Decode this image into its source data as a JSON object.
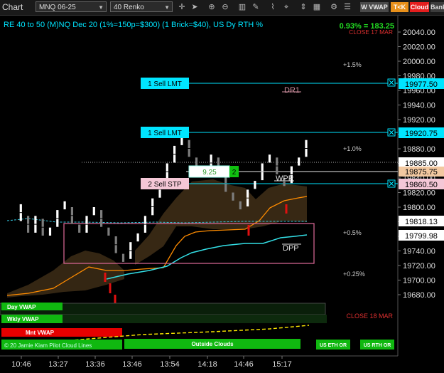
{
  "toolbar": {
    "title": "Chart",
    "instrument": "MNQ 06-25",
    "bar_type": "40 Renko",
    "wvwap": "W VWAP",
    "tok": "T<K",
    "cloud": "Cloud",
    "renko": "Banko",
    "icons": [
      "crosshair-icon",
      "cursor-icon",
      "zoom-in-icon",
      "zoom-out-icon",
      "bar-style-icon",
      "draw-tool-icon",
      "indicator-icon",
      "strategy-icon",
      "scale-icon",
      "layout-icon",
      "properties-icon",
      "menu-icon"
    ]
  },
  "chart_title": "RE 40 to 50 (M)NQ Dec 20 (1%=150p=$300) (1 Brick=$40), US Dy RTH %",
  "pnl": "0.93% = 183.25",
  "close_top": "CLOSE 17 MAR",
  "close_bottom": "CLOSE 18 MAR",
  "pct_labels": {
    "p15": "+1.5%",
    "p10": "+1.0%",
    "p05": "+0.5%",
    "p025": "+0.25%"
  },
  "level_labels": {
    "dr1": "DR1",
    "wpp": "WPP",
    "dpp": "DPP"
  },
  "orders": {
    "sell_lmt_1": "1 Sell LMT",
    "sell_lmt_2": "1 Sell LMT",
    "sell_stp": "2 Sell STP",
    "position_price": "9.25",
    "position_qty": "2"
  },
  "axis": {
    "ticks": [
      "20040.00",
      "20020.00",
      "20000.00",
      "19980.00",
      "19960.00",
      "19940.00",
      "19920.00",
      "19900.00",
      "19880.00",
      "19860.00",
      "19840.00",
      "19820.00",
      "19800.00",
      "19780.00",
      "19760.00",
      "19740.00",
      "19720.00",
      "19700.00",
      "19680.00"
    ],
    "tags": {
      "sell_lmt_1": "19977.50",
      "sell_lmt_2": "19920.75",
      "last": "19885.00",
      "avg": "19875.75",
      "sell_stp": "19860.50",
      "vwap": "19818.13",
      "cyan": "19799.98"
    }
  },
  "time_labels": [
    "10:46",
    "13:27",
    "13:36",
    "13:46",
    "13:54",
    "14:18",
    "14:46",
    "15:17"
  ],
  "panel": {
    "day_vwap": "Day VWAP",
    "wkly_vwap": "Wkly VWAP",
    "mnt_vwap": "Mnt VWAP",
    "cloud_lines": "© 20 Jamie Kiam Pilot Cloud Lines",
    "outside_clouds": "Outside Clouds",
    "us_eth": "US ETH OR",
    "us_rth": "US RTH OR"
  },
  "colors": {
    "order_cyan": "#00e5ff",
    "stop_pink": "#f4c7d6",
    "up_brick": "#ffffff",
    "down_brick": "#7d7d7d",
    "red_brick": "#e01010",
    "panel_green": "#10b810",
    "panel_red": "#e60000",
    "cloud_brown": "#3a2a15",
    "orange_line": "#ff8c00",
    "cyan_line": "#33dfe6"
  },
  "chart_data": {
    "type": "renko",
    "brick_size": 40,
    "ylim": [
      19665,
      20050
    ],
    "bricks": [
      [
        -19.0,
        19780.0,
        19792.0
      ],
      [
        -19.0,
        19792.0,
        19804.0
      ],
      [
        -18.0,
        19788.0,
        19776.0
      ],
      [
        -18.0,
        19776.0,
        19764.0
      ],
      [
        -17.0,
        19764.0,
        19776.0
      ],
      [
        -17.0,
        19776.0,
        19788.0
      ],
      [
        -16.0,
        19784.0,
        19772.0
      ],
      [
        -16.0,
        19772.0,
        19760.0
      ],
      [
        -15.0,
        19760.0,
        19772.0
      ],
      [
        -14.0,
        19772.0,
        19784.0
      ],
      [
        -14.0,
        19784.0,
        19796.0
      ],
      [
        -13.0,
        19796.0,
        19808.0
      ],
      [
        -12.0,
        19800.0,
        19788.0
      ],
      [
        -12.0,
        19788.0,
        19776.0
      ],
      [
        -11.0,
        19776.0,
        19764.0
      ],
      [
        -10.0,
        19764.0,
        19776.0
      ],
      [
        -10.0,
        19776.0,
        19788.0
      ],
      [
        -9.0,
        19788.0,
        19800.0
      ],
      [
        -8.0,
        19796.0,
        19784.0
      ],
      [
        -8.0,
        19784.0,
        19772.0
      ],
      [
        -7.0,
        19772.0,
        19760.0
      ],
      [
        -6.0,
        19760.0,
        19748.0
      ],
      [
        -6.0,
        19748.0,
        19736.0
      ],
      [
        -5.0,
        19736.0,
        19724.0
      ],
      [
        -4.0,
        19728.0,
        19740.0
      ],
      [
        -4.0,
        19740.0,
        19752.0
      ],
      [
        -3.0,
        19752.0,
        19764.0
      ],
      [
        -2.0,
        19764.0,
        19776.0
      ],
      [
        -2.0,
        19776.0,
        19788.0
      ],
      [
        -1.0,
        19788.0,
        19800.0
      ],
      [
        -1.0,
        19800.0,
        19812.0
      ],
      [
        0.0,
        19812.0,
        19824.0
      ],
      [
        0.0,
        19824.0,
        19836.0
      ],
      [
        1.0,
        19836.0,
        19848.0
      ],
      [
        1.0,
        19848.0,
        19860.0
      ],
      [
        2.0,
        19860.0,
        19872.0
      ],
      [
        2.0,
        19872.0,
        19884.0
      ],
      [
        3.0,
        19884.0,
        19896.0
      ],
      [
        4.0,
        19892.0,
        19880.0
      ],
      [
        4.0,
        19880.0,
        19868.0
      ],
      [
        5.0,
        19868.0,
        19856.0
      ],
      [
        6.0,
        19856.0,
        19844.0
      ],
      [
        7.0,
        19848.0,
        19860.0
      ],
      [
        7.0,
        19860.0,
        19872.0
      ],
      [
        8.0,
        19868.0,
        19856.0
      ],
      [
        8.0,
        19856.0,
        19844.0
      ],
      [
        9.0,
        19844.0,
        19832.0
      ],
      [
        9.0,
        19832.0,
        19820.0
      ],
      [
        10.0,
        19820.0,
        19808.0
      ],
      [
        11.0,
        19808.0,
        19796.0
      ],
      [
        12.0,
        19800.0,
        19812.0
      ],
      [
        12.0,
        19812.0,
        19824.0
      ],
      [
        13.0,
        19824.0,
        19836.0
      ],
      [
        14.0,
        19836.0,
        19848.0
      ],
      [
        14.0,
        19848.0,
        19860.0
      ],
      [
        15.0,
        19860.0,
        19872.0
      ],
      [
        16.0,
        19868.0,
        19856.0
      ],
      [
        16.0,
        19856.0,
        19844.0
      ],
      [
        17.0,
        19840.0,
        19828.0
      ],
      [
        18.0,
        19832.0,
        19844.0
      ],
      [
        18.0,
        19844.0,
        19856.0
      ],
      [
        19.0,
        19856.0,
        19868.0
      ],
      [
        20.0,
        19868.0,
        19880.0
      ],
      [
        20.0,
        19880.0,
        19892.0
      ]
    ]
  }
}
